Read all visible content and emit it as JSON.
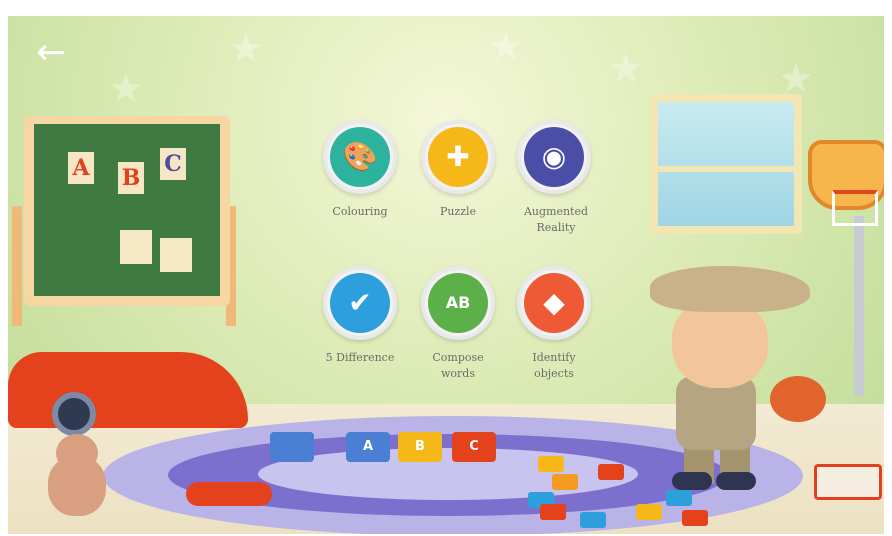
{
  "nav": {
    "back_icon": "arrow-left-icon",
    "back_glyph": "←"
  },
  "chalkboard": {
    "letters": [
      "A",
      "B",
      "C"
    ]
  },
  "train": {
    "cars": [
      "A",
      "B",
      "C"
    ]
  },
  "menu": {
    "items": [
      {
        "label": "Colouring",
        "icon": "palette-icon",
        "glyph": "🎨",
        "color": "#2db39d"
      },
      {
        "label": "Puzzle",
        "icon": "puzzle-icon",
        "glyph": "✚",
        "color": "#f6b719"
      },
      {
        "label": "Augmented Reality",
        "icon": "vr-headset-icon",
        "glyph": "◉",
        "color": "#4b4ea6"
      },
      {
        "label": "5 Difference",
        "icon": "checkmark-icon",
        "glyph": "✔",
        "color": "#2c9fdc"
      },
      {
        "label": "Compose words",
        "icon": "letter-blocks-icon",
        "glyph": "AB",
        "color": "#5bb04a"
      },
      {
        "label": "Identify objects",
        "icon": "shapes-icon",
        "glyph": "◆",
        "color": "#ef5a36"
      }
    ]
  }
}
